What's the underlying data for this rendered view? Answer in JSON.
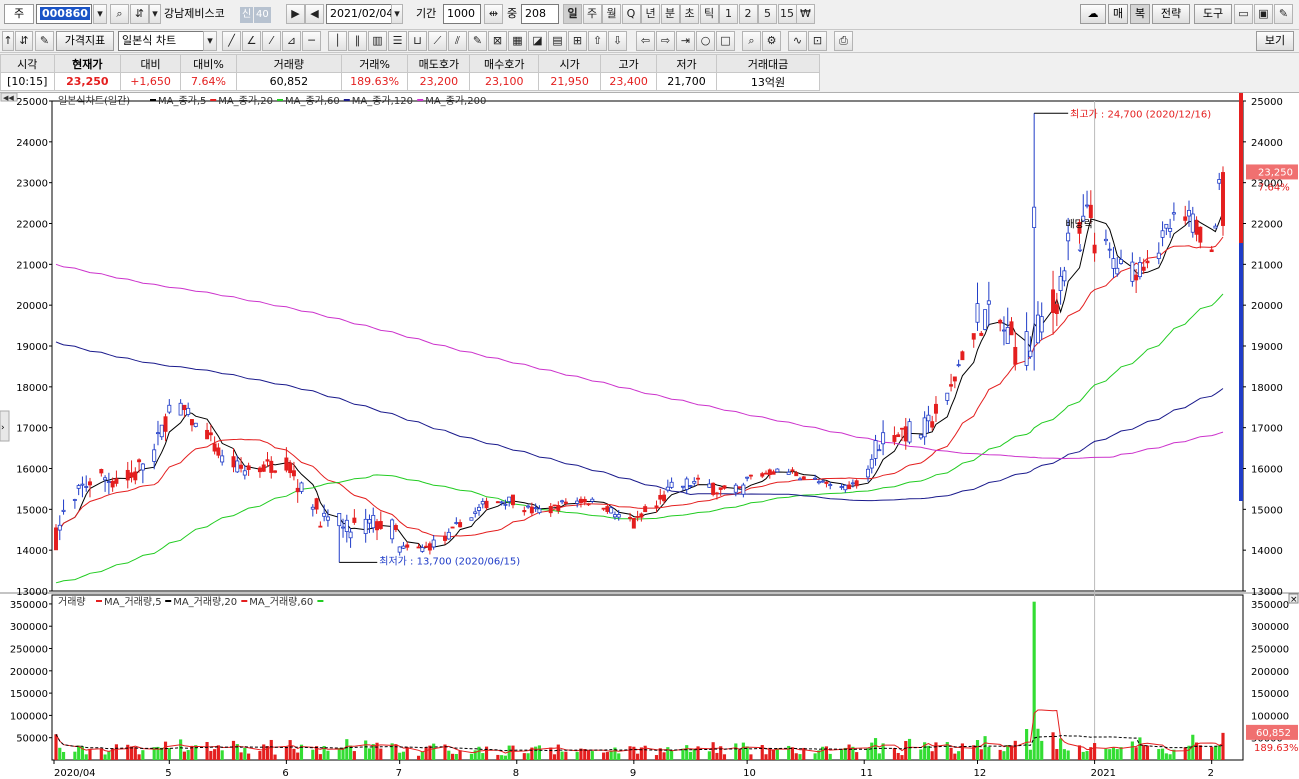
{
  "toolbar": {
    "market_prefix": "주",
    "code": "000860",
    "stock_name": "강남제비스코",
    "credit_badge": "신",
    "margin_badge": "40",
    "date": "2021/02/04",
    "period_label": "기간",
    "period_value": "1000",
    "overlap_label": "중",
    "overlap_value": "208",
    "timeframes": [
      "일",
      "주",
      "월",
      "Q",
      "년",
      "분",
      "초",
      "틱",
      "1",
      "2",
      "5",
      "15"
    ],
    "selected_timeframe": "일",
    "right_buttons": [
      "매",
      "복",
      "전략",
      "도구"
    ],
    "price_index_label": "가격지표",
    "chart_type": "일본식 차트",
    "view_button": "보기"
  },
  "quote": {
    "headers": [
      "시각",
      "현재가",
      "대비",
      "대비%",
      "거래량",
      "거래%",
      "매도호가",
      "매수호가",
      "시가",
      "고가",
      "저가",
      "거래대금"
    ],
    "values": [
      "[10:15]",
      "23,250",
      "+1,650",
      "7.64%",
      "60,852",
      "189.63%",
      "23,200",
      "23,100",
      "21,950",
      "23,400",
      "21,700",
      "13억원"
    ]
  },
  "price_panel": {
    "legend_title": "일본식차트(일간)",
    "ma_legend": [
      {
        "label": "MA_종가,5",
        "color": "#000000"
      },
      {
        "label": "MA_종가,20",
        "color": "#e41f1f"
      },
      {
        "label": "MA_종가,60",
        "color": "#22cc22"
      },
      {
        "label": "MA_종가,120",
        "color": "#1a1a8c"
      },
      {
        "label": "MA_종가,200",
        "color": "#cc33cc"
      }
    ],
    "high_annotation": "최고가 : 24,700 (2020/12/16)",
    "low_annotation": "최저가 : 13,700 (2020/06/15)",
    "dividend_label": "배당락",
    "current_price_tag": "23,250",
    "current_change_tag": "7.64%"
  },
  "volume_panel": {
    "legend_title": "거래량",
    "ma_legend": [
      {
        "label": "MA_거래량,5",
        "color": "#e41f1f"
      },
      {
        "label": "MA_거래량,20",
        "color": "#000000"
      },
      {
        "label": "MA_거래량,60",
        "color": "#e41f1f"
      }
    ],
    "extra_dot_color": "#22cc22",
    "volume_tag": "60,852",
    "volume_pct_tag": "189.63%"
  },
  "chart_data": [
    {
      "type": "candlestick",
      "title": "일본식차트(일간)",
      "ylim": [
        13000,
        25000
      ],
      "y_ticks": [
        13000,
        14000,
        15000,
        16000,
        17000,
        18000,
        19000,
        20000,
        21000,
        22000,
        23000,
        24000,
        25000
      ],
      "x_tick_labels": [
        "2020/04",
        "5",
        "6",
        "7",
        "8",
        "9",
        "10",
        "11",
        "12",
        "2021",
        "2"
      ],
      "x_range": [
        "2020-04-01",
        "2021-02-04"
      ],
      "monthly_closes": [
        {
          "month": "2020/04",
          "open": 14300,
          "close": 17200,
          "high": 17800,
          "low": 14200
        },
        {
          "month": "2020/05",
          "open": 17200,
          "close": 15800,
          "high": 17700,
          "low": 15400
        },
        {
          "month": "2020/06",
          "open": 15800,
          "close": 14000,
          "high": 16800,
          "low": 13700
        },
        {
          "month": "2020/07",
          "open": 14000,
          "close": 15200,
          "high": 15300,
          "low": 13800
        },
        {
          "month": "2020/08",
          "open": 15200,
          "close": 14900,
          "high": 15900,
          "low": 14500
        },
        {
          "month": "2020/09",
          "open": 14900,
          "close": 15800,
          "high": 16800,
          "low": 14700
        },
        {
          "month": "2020/10",
          "open": 15800,
          "close": 15700,
          "high": 16100,
          "low": 15000
        },
        {
          "month": "2020/11",
          "open": 15700,
          "close": 18800,
          "high": 19000,
          "low": 15500
        },
        {
          "month": "2020/12",
          "open": 18800,
          "close": 21300,
          "high": 24700,
          "low": 18400
        },
        {
          "month": "2021/01",
          "open": 21300,
          "close": 21600,
          "high": 23700,
          "low": 20100
        },
        {
          "month": "2021/02",
          "open": 21600,
          "close": 23250,
          "high": 23400,
          "low": 21500
        }
      ],
      "series": [
        {
          "name": "MA_종가,5",
          "color": "#000000"
        },
        {
          "name": "MA_종가,20",
          "color": "#e41f1f"
        },
        {
          "name": "MA_종가,60",
          "color": "#22cc22"
        },
        {
          "name": "MA_종가,120",
          "color": "#1a1a8c"
        },
        {
          "name": "MA_종가,200",
          "color": "#cc33cc"
        }
      ],
      "annotations": [
        {
          "text": "최고가 : 24,700 (2020/12/16)",
          "x": "2020-12-16",
          "y": 24700
        },
        {
          "text": "최저가 : 13,700 (2020/06/15)",
          "x": "2020-06-15",
          "y": 13700
        }
      ],
      "last_price": 23250,
      "grid": false
    },
    {
      "type": "bar",
      "title": "거래량",
      "ylim": [
        0,
        370000
      ],
      "y_ticks": [
        50000,
        100000,
        150000,
        200000,
        250000,
        300000,
        350000
      ],
      "peak_volume": {
        "date": "2020-12-16",
        "value": 355000
      },
      "last_volume": 60852,
      "series": [
        {
          "name": "MA_거래량,5",
          "color": "#e41f1f"
        },
        {
          "name": "MA_거래량,20",
          "color": "#000000"
        },
        {
          "name": "MA_거래량,60",
          "color": "#e41f1f"
        }
      ]
    }
  ]
}
